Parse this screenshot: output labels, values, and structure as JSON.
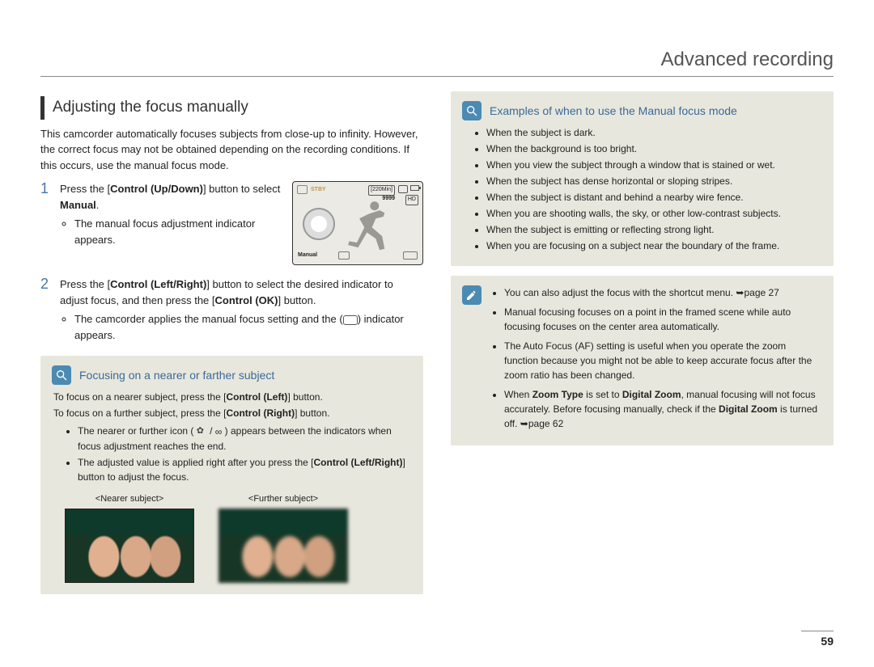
{
  "page": {
    "title": "Advanced recording",
    "number": "59"
  },
  "left": {
    "heading": "Adjusting the focus manually",
    "intro": "This camcorder automatically focuses subjects from close-up to infinity. However, the correct focus may not be obtained depending on the recording conditions. If this occurs, use the manual focus mode.",
    "step1_num": "1",
    "step1_a": "Press the [",
    "step1_b": "Control (Up/Down)",
    "step1_c": "] button to select ",
    "step1_d": "Manual",
    "step1_e": ".",
    "step1_bullet": "The manual focus adjustment indicator appears.",
    "lcd": {
      "stby": "STBY",
      "time": "[220Min]",
      "count": "9999",
      "hd": "HD",
      "manual": "Manual"
    },
    "step2_num": "2",
    "step2_a": "Press the [",
    "step2_b": "Control (Left/Right)",
    "step2_c": "] button to select the desired indicator to adjust focus, and then press the [",
    "step2_d": "Control (OK)",
    "step2_e": "] button.",
    "step2_bullet_a": "The camcorder applies the manual focus setting and the (",
    "step2_bullet_b": ") indicator appears."
  },
  "focus_box": {
    "title": "Focusing on a nearer or farther subject",
    "p1_a": "To focus on a nearer subject, press the [",
    "p1_b": "Control (Left)",
    "p1_c": "] button.",
    "p2_a": "To focus on a further subject, press the [",
    "p2_b": "Control (Right)",
    "p2_c": "] button.",
    "b1_a": "The nearer or further icon ( ",
    "b1_b": " / ",
    "b1_c": " ) appears between the indicators when focus adjustment reaches the end.",
    "b2_a": "The adjusted value is applied right after you press the [",
    "b2_b": "Control (Left/Right)",
    "b2_c": "] button to adjust the focus.",
    "nearer_label": "<Nearer subject>",
    "further_label": "<Further subject>"
  },
  "examples_box": {
    "title": "Examples of when to use the Manual focus mode",
    "items": [
      "When the subject is dark.",
      "When the background is too bright.",
      "When you view the subject through a window that is stained or wet.",
      "When the subject has dense horizontal or sloping stripes.",
      "When the subject is distant and behind a nearby wire fence.",
      "When you are shooting walls, the sky, or other low-contrast subjects.",
      "When the subject is emitting or reflecting strong light.",
      "When you are focusing on a subject near the boundary of the frame."
    ]
  },
  "notes": {
    "n1_a": "You can also adjust the focus with the shortcut menu. ",
    "n1_arrow": "➥",
    "n1_b": "page 27",
    "n2": "Manual focusing focuses on a point in the framed scene while auto focusing focuses on the center area automatically.",
    "n3": "The Auto Focus (AF) setting is useful when you operate the zoom function because you might not be able to keep accurate focus after the zoom ratio has been changed.",
    "n4_a": "When ",
    "n4_b": "Zoom Type",
    "n4_c": " is set to ",
    "n4_d": "Digital Zoom",
    "n4_e": ", manual focusing will not focus accurately. Before focusing manually, check if the ",
    "n4_f": "Digital Zoom",
    "n4_g": " is turned off. ",
    "n4_arrow": "➥",
    "n4_h": "page 62"
  }
}
